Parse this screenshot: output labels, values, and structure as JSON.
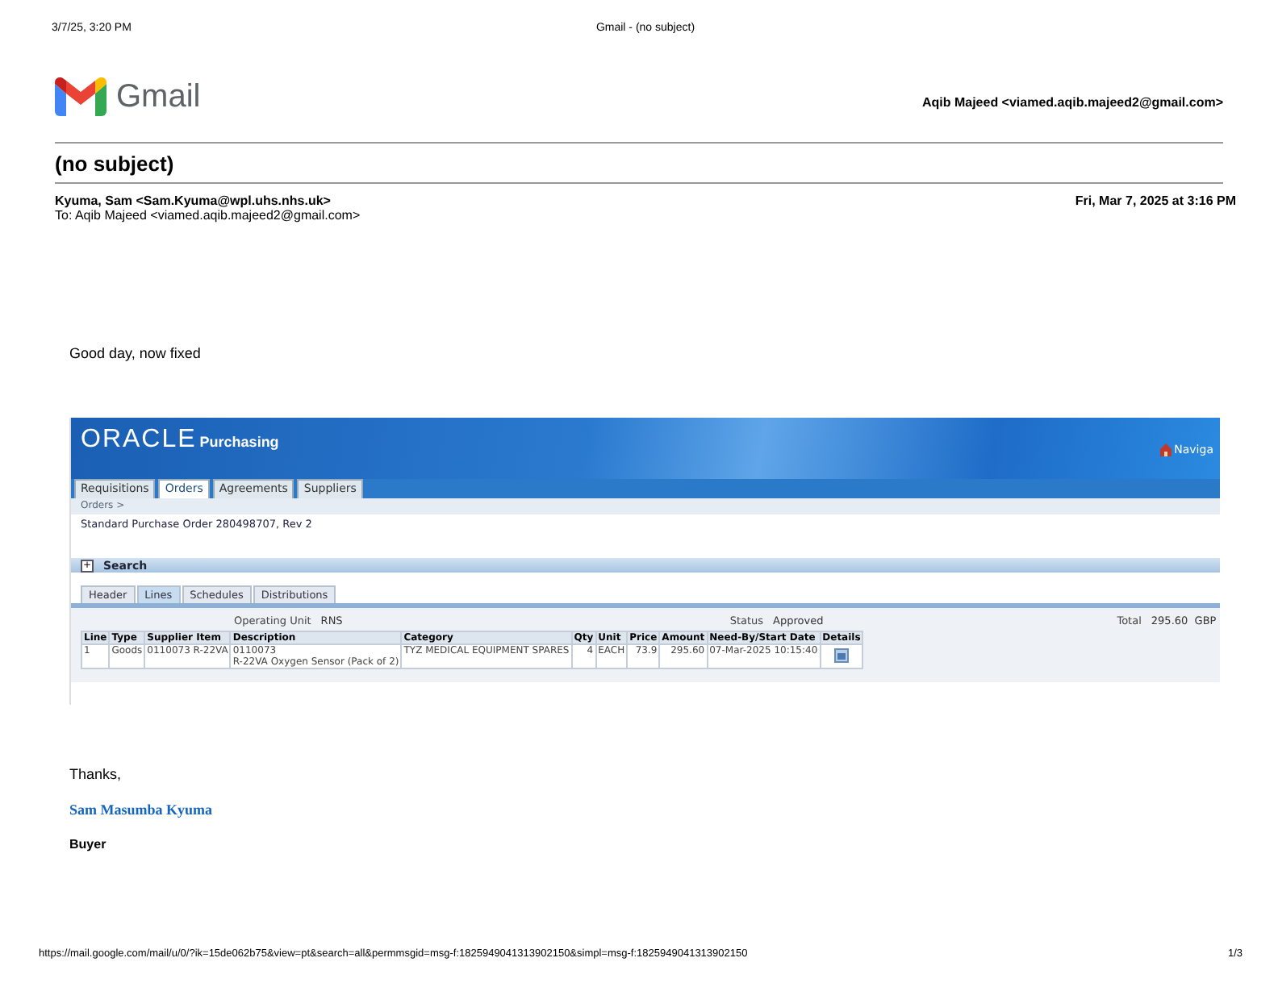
{
  "print_header": {
    "datetime": "3/7/25, 3:20 PM",
    "page_title": "Gmail - (no subject)"
  },
  "gmail": {
    "logo_text": "Gmail",
    "account": "Aqib Majeed <viamed.aqib.majeed2@gmail.com>"
  },
  "subject": "(no subject)",
  "message": {
    "from": "Kyuma, Sam <Sam.Kyuma@wpl.uhs.nhs.uk>",
    "date": "Fri, Mar 7, 2025 at 3:16 PM",
    "to": "To: Aqib Majeed <viamed.aqib.majeed2@gmail.com>",
    "greeting": "Good day, now fixed",
    "screenshot": {
      "brand": "ORACLE",
      "product": "Purchasing",
      "nav_link": "Naviga",
      "tabs": [
        {
          "label": "Requisitions",
          "selected": false
        },
        {
          "label": "Orders",
          "selected": true
        },
        {
          "label": "Agreements",
          "selected": false
        },
        {
          "label": "Suppliers",
          "selected": false
        }
      ],
      "breadcrumb": "Orders >",
      "page_heading": "Standard Purchase Order 280498707, Rev 2",
      "search_toggle": "+",
      "search_label": "Search",
      "subtabs": [
        {
          "label": "Header",
          "selected": false
        },
        {
          "label": "Lines",
          "selected": true
        },
        {
          "label": "Schedules",
          "selected": false
        },
        {
          "label": "Distributions",
          "selected": false
        }
      ],
      "summary": [
        {
          "label": "Operating Unit",
          "value": "RNS"
        },
        {
          "label": "Status",
          "value": "Approved"
        },
        {
          "label": "Total",
          "value": "295.60  GBP"
        }
      ],
      "table": {
        "columns": [
          "Line",
          "Type",
          "Supplier Item",
          "Description",
          "Category",
          "Qty",
          "Unit",
          "Price",
          "Amount",
          "Need-By/Start Date",
          "Details"
        ],
        "rows": [
          {
            "cells": [
              "1",
              "Goods",
              "0110073 R-22VA",
              "0110073\nR-22VA Oxygen Sensor (Pack of 2)",
              "TYZ MEDICAL EQUIPMENT SPARES",
              "4",
              "EACH",
              "73.9",
              "295.60",
              "07-Mar-2025 10:15:40",
              ""
            ]
          }
        ]
      }
    },
    "closing": "Thanks,",
    "signature_name": "Sam Masumba Kyuma",
    "signature_role": "Buyer"
  },
  "print_footer": {
    "url": "https://mail.google.com/mail/u/0/?ik=15de062b75&view=pt&search=all&permmsgid=msg-f:1825949041313902150&simpl=msg-f:1825949041313902150",
    "page": "1/3"
  }
}
